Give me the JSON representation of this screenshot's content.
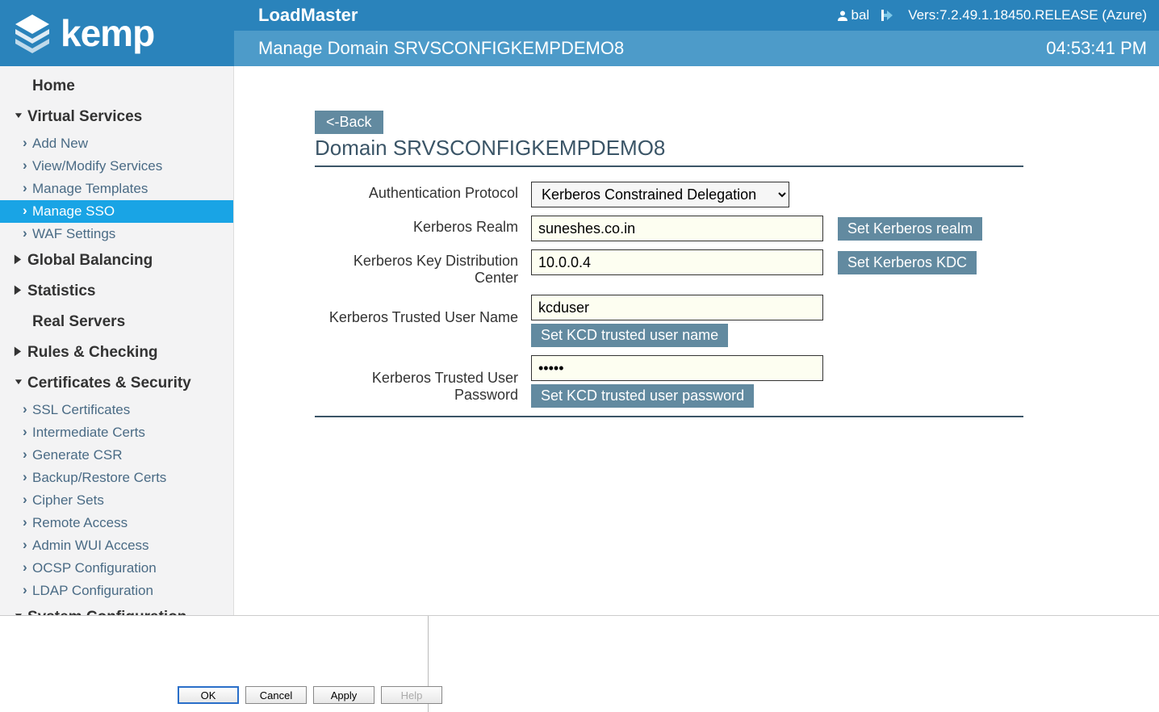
{
  "header": {
    "brand": "kemp",
    "product": "LoadMaster",
    "subtitle": "Manage Domain SRVSCONFIGKEMPDEMO8",
    "user": "bal",
    "version": "Vers:7.2.49.1.18450.RELEASE (Azure)",
    "time": "04:53:41 PM"
  },
  "sidebar": {
    "home": "Home",
    "sections": [
      {
        "label": "Virtual Services",
        "expanded": true,
        "items": [
          "Add New",
          "View/Modify Services",
          "Manage Templates",
          "Manage SSO",
          "WAF Settings"
        ],
        "active": "Manage SSO"
      },
      {
        "label": "Global Balancing",
        "expanded": false
      },
      {
        "label": "Statistics",
        "expanded": false
      },
      {
        "label": "Real Servers",
        "plain": true
      },
      {
        "label": "Rules & Checking",
        "expanded": false
      },
      {
        "label": "Certificates & Security",
        "expanded": true,
        "items": [
          "SSL Certificates",
          "Intermediate Certs",
          "Generate CSR",
          "Backup/Restore Certs",
          "Cipher Sets",
          "Remote Access",
          "Admin WUI Access",
          "OCSP Configuration",
          "LDAP Configuration"
        ]
      },
      {
        "label": "System Configuration",
        "expanded": true
      }
    ]
  },
  "main": {
    "back": "<-Back",
    "title": "Domain SRVSCONFIGKEMPDEMO8",
    "fields": {
      "auth_protocol": {
        "label": "Authentication Protocol",
        "value": "Kerberos Constrained Delegation"
      },
      "realm": {
        "label": "Kerberos Realm",
        "value": "suneshes.co.in",
        "btn": "Set Kerberos realm"
      },
      "kdc": {
        "label": "Kerberos Key Distribution Center",
        "value": "10.0.0.4",
        "btn": "Set Kerberos KDC"
      },
      "user": {
        "label": "Kerberos Trusted User Name",
        "value": "kcduser",
        "btn": "Set KCD trusted user name"
      },
      "pass": {
        "label": "Kerberos Trusted User Password",
        "value": "•••••",
        "btn": "Set KCD trusted user password"
      }
    }
  },
  "footer": {
    "ok": "OK",
    "cancel": "Cancel",
    "apply": "Apply",
    "help": "Help"
  }
}
